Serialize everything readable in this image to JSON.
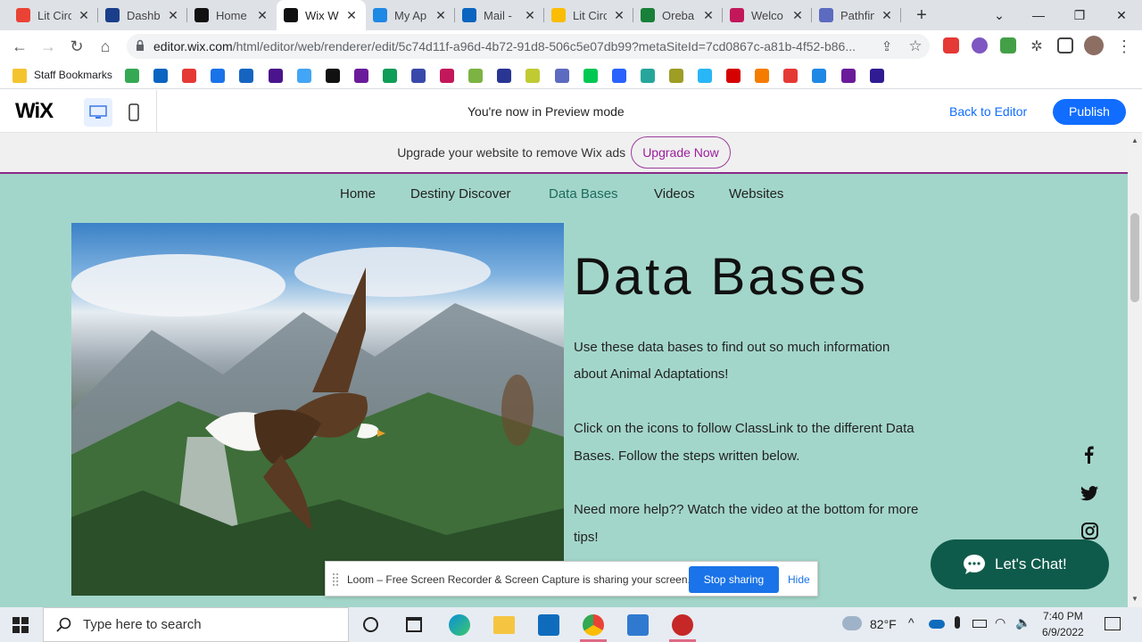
{
  "browser": {
    "tabs": [
      {
        "title": "Lit Circ",
        "color": "#ea4335"
      },
      {
        "title": "Dashbo",
        "color": "#1a3e8a"
      },
      {
        "title": "Home",
        "color": "#111111"
      },
      {
        "title": "Wix W",
        "color": "#111111"
      },
      {
        "title": "My Ap",
        "color": "#1e88e5"
      },
      {
        "title": "Mail -",
        "color": "#0a64c0"
      },
      {
        "title": "Lit Circ",
        "color": "#fbbc04"
      },
      {
        "title": "Oreba",
        "color": "#188038"
      },
      {
        "title": "Welco",
        "color": "#c2185b"
      },
      {
        "title": "Pathfin",
        "color": "#5c6bc0"
      }
    ],
    "new_tab_symbol": "+",
    "url_host": "editor.wix.com",
    "url_path": "/html/editor/web/renderer/edit/5c74d11f-a96d-4b72-91d8-506c5e07db99?metaSiteId=7cd0867c-a81b-4f52-b86...",
    "bookmarks_folder": "Staff Bookmarks"
  },
  "wix": {
    "logo": "WiX",
    "preview_text": "You're now in Preview mode",
    "back_label": "Back to Editor",
    "publish_label": "Publish"
  },
  "site": {
    "ad_text": "Upgrade your website to remove Wix ads",
    "upgrade_label": "Upgrade Now",
    "nav": [
      "Home",
      "Destiny Discover",
      "Data Bases",
      "Videos",
      "Websites"
    ],
    "title": "Data Bases",
    "p1": "Use these data bases to find out so much information about Animal Adaptations!",
    "p2": "Click on the icons to follow ClassLink to the different Data Bases.  Follow the steps written below.",
    "p3": "Need more help??  Watch the video at the bottom for more tips!",
    "chat_label": "Let's Chat!",
    "social": [
      "facebook-icon",
      "twitter-icon",
      "instagram-icon"
    ]
  },
  "loom": {
    "text": "Loom – Free Screen Recorder & Screen Capture is sharing your screen.",
    "stop_label": "Stop sharing",
    "hide_label": "Hide"
  },
  "taskbar": {
    "search_placeholder": "Type here to search",
    "temp": "82°F",
    "time": "7:40 PM",
    "date": "6/9/2022"
  }
}
